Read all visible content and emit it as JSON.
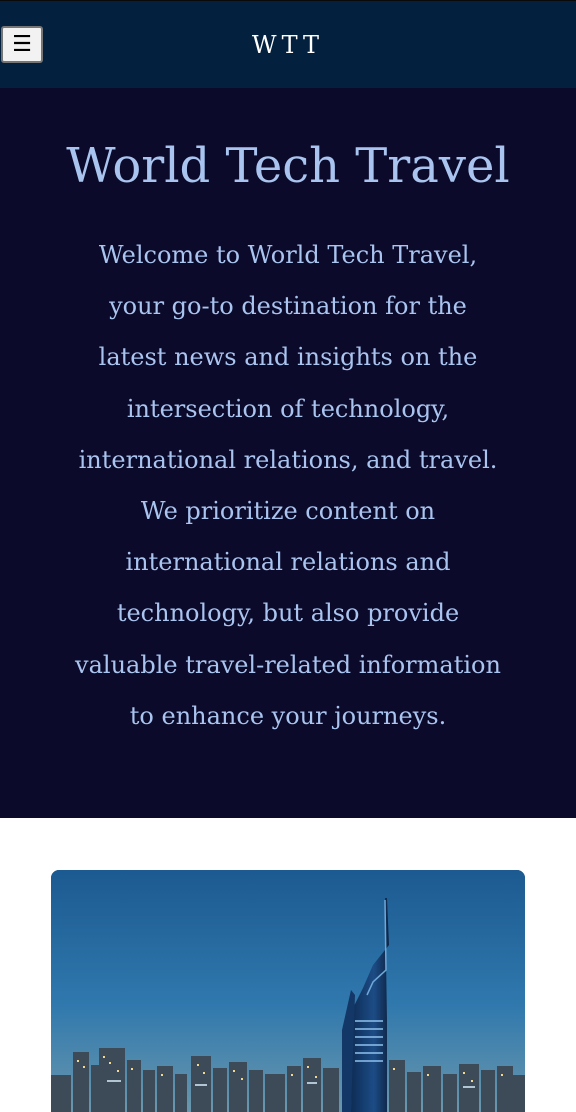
{
  "header": {
    "menu_label": "☰",
    "brand": "WTT"
  },
  "hero": {
    "title": "World Tech Travel",
    "intro": "Welcome to World Tech Travel, your go-to destination for the latest news and insights on the intersection of technology, international relations, and travel. We prioritize content on international relations and technology, but also provide valuable travel-related information to enhance your journeys."
  },
  "colors": {
    "header_bg": "#03203f",
    "hero_bg": "#0c0a2a",
    "hero_text": "#a9c4ef"
  }
}
